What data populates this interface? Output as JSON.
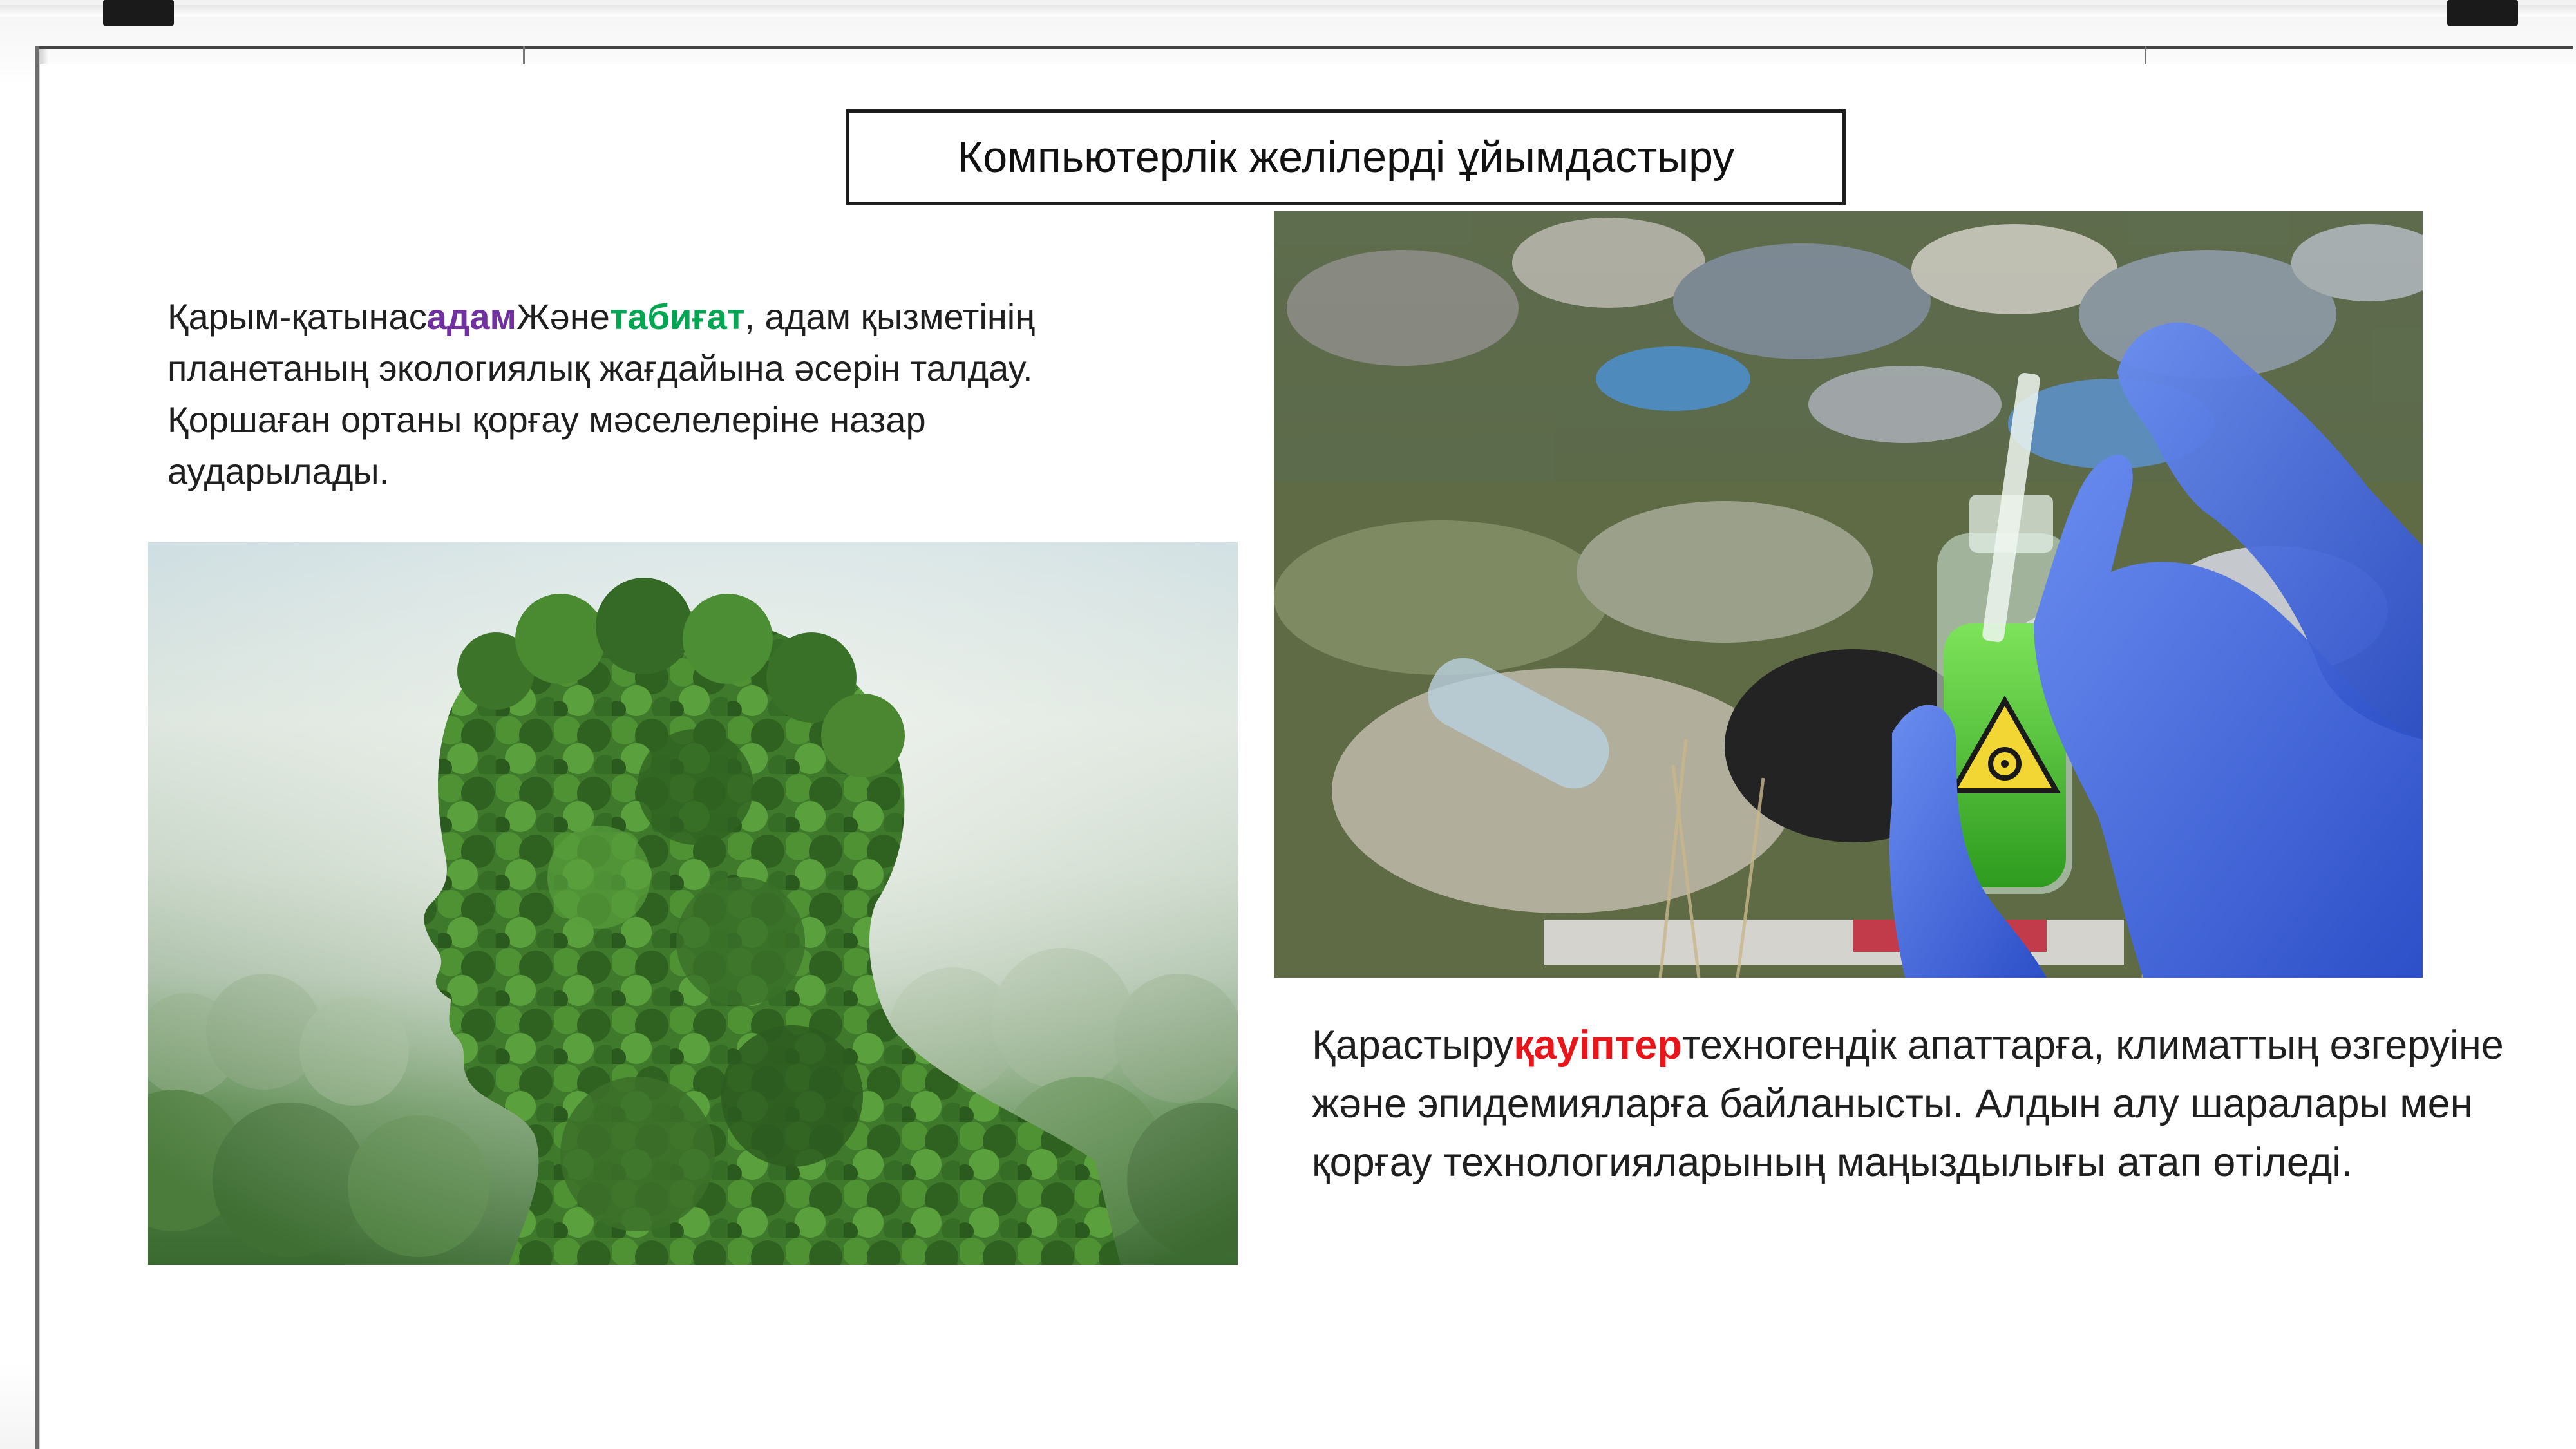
{
  "slide": {
    "title": "Компьютерлік желілерді ұйымдастыру",
    "left_paragraph": {
      "prefix": "Қарым-қатынас",
      "word1": "адам",
      "middle": "Және",
      "word2": "табиғат",
      "suffix": ", адам қызметінің планетаның экологиялық жағдайына әсерін талдау. Қоршаған ортаны қорғау мәселелеріне назар аударылады."
    },
    "right_paragraph": {
      "prefix": "Қарастыру",
      "word": "қауіптер",
      "suffix": "техногендік апаттарға, климаттың өзгеруіне және эпидемияларға байланысты. Алдын алу шаралары мен қорғау технологияларының маңыздылығы атап өтіледі."
    }
  },
  "images": {
    "left": "head-forest-silhouette",
    "right": "biohazard-sample-in-waste"
  },
  "colors": {
    "highlight_purple": "#7030a0",
    "highlight_green": "#00a651",
    "highlight_red": "#e8161b"
  }
}
